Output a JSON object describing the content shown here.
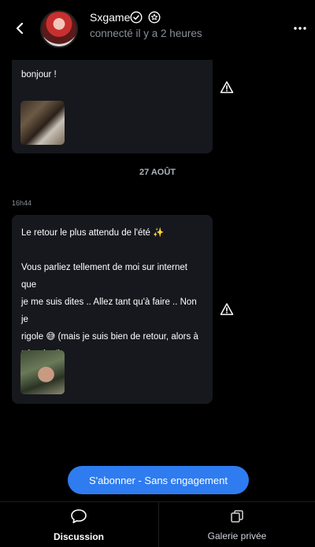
{
  "header": {
    "name": "Sxgame",
    "status": "connecté il y a 2 heures",
    "icons": [
      "back-arrow-icon",
      "verified-badge-icon",
      "star-badge-icon",
      "more-options-icon"
    ]
  },
  "messages": [
    {
      "text": "bonjour !",
      "has_image": true
    },
    {
      "date": "27 AOÛT",
      "time": "16h44",
      "lines": [
        "Le retour le plus attendu de l'été ✨",
        "",
        "Vous parliez tellement de moi sur internet que",
        "je me suis dites .. Allez tant qu'à faire .. Non je",
        "rigole 😅 (mais je suis bien de retour, alors à",
        "très vite !)"
      ],
      "has_image": true
    }
  ],
  "cta": {
    "label": "S'abonner - Sans engagement"
  },
  "tabs": [
    {
      "label": "Discussion",
      "icon": "chat-bubble-icon"
    },
    {
      "label": "Galerie privée",
      "icon": "gallery-icon"
    }
  ],
  "colors": {
    "accent": "#2f7cf0",
    "bubble": "#16181e",
    "background": "#000000"
  }
}
